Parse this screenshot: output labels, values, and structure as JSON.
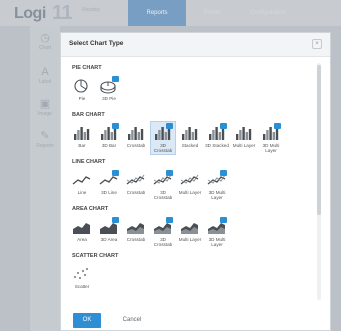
{
  "app": {
    "logo_text": "Logi",
    "logo_version": "11",
    "logo_subtitle": "Reporting",
    "nav": {
      "reports": "Reports",
      "profile": "Profile",
      "configuration": "Configuration"
    },
    "sidebar": [
      {
        "label": "Chart",
        "icon": "clock-icon"
      },
      {
        "label": "Label",
        "icon": "text-icon"
      },
      {
        "label": "Image",
        "icon": "image-icon"
      },
      {
        "label": "Reports",
        "icon": "report-icon"
      }
    ]
  },
  "dialog": {
    "title": "Select Chart Type",
    "close_glyph": "×",
    "ok_label": "OK",
    "cancel_label": "Cancel",
    "accent_color": "#2f8fd5",
    "sections": [
      {
        "title": "PIE CHART",
        "items": [
          {
            "label": "Pie",
            "icon": "pie-icon",
            "badge": false
          },
          {
            "label": "3D Pie",
            "icon": "pie-3d-icon",
            "badge": true
          }
        ]
      },
      {
        "title": "BAR CHART",
        "items": [
          {
            "label": "Bar",
            "icon": "bar-icon",
            "badge": false
          },
          {
            "label": "3D Bar",
            "icon": "bar-3d-icon",
            "badge": true
          },
          {
            "label": "Crosstab",
            "icon": "bar-crosstab-icon",
            "badge": false
          },
          {
            "label": "3D Crosstab",
            "icon": "bar-3d-crosstab-icon",
            "badge": true,
            "selected": true
          },
          {
            "label": "Stacked",
            "icon": "bar-stacked-icon",
            "badge": false
          },
          {
            "label": "3D Stacked",
            "icon": "bar-3d-stacked-icon",
            "badge": true
          },
          {
            "label": "Multi Layer",
            "icon": "bar-multilayer-icon",
            "badge": false
          },
          {
            "label": "3D Multi Layer",
            "icon": "bar-3d-multilayer-icon",
            "badge": true
          }
        ]
      },
      {
        "title": "LINE CHART",
        "items": [
          {
            "label": "Line",
            "icon": "line-icon",
            "badge": false
          },
          {
            "label": "3D Line",
            "icon": "line-3d-icon",
            "badge": true
          },
          {
            "label": "Crosstab",
            "icon": "line-crosstab-icon",
            "badge": false
          },
          {
            "label": "3D Crosstab",
            "icon": "line-3d-crosstab-icon",
            "badge": true
          },
          {
            "label": "Multi Layer",
            "icon": "line-multilayer-icon",
            "badge": false
          },
          {
            "label": "3D Multi Layer",
            "icon": "line-3d-multilayer-icon",
            "badge": true
          }
        ]
      },
      {
        "title": "AREA CHART",
        "items": [
          {
            "label": "Area",
            "icon": "area-icon",
            "badge": false
          },
          {
            "label": "3D Area",
            "icon": "area-3d-icon",
            "badge": true
          },
          {
            "label": "Crosstab",
            "icon": "area-crosstab-icon",
            "badge": false
          },
          {
            "label": "3D Crosstab",
            "icon": "area-3d-crosstab-icon",
            "badge": true
          },
          {
            "label": "Multi Layer",
            "icon": "area-multilayer-icon",
            "badge": false
          },
          {
            "label": "3D Multi Layer",
            "icon": "area-3d-multilayer-icon",
            "badge": true
          }
        ]
      },
      {
        "title": "SCATTER CHART",
        "items": [
          {
            "label": "Scatter",
            "icon": "scatter-icon",
            "badge": false
          }
        ]
      }
    ]
  }
}
